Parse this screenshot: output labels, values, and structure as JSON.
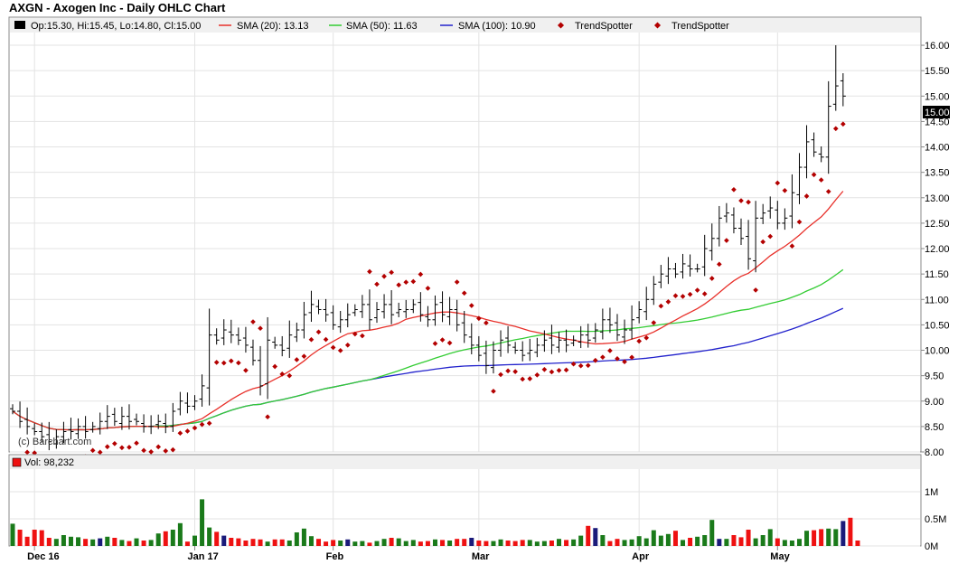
{
  "header": {
    "title": "AXGN - Axogen Inc - Daily OHLC Chart"
  },
  "legend": {
    "ohlc": "Op:15.30, Hi:15.45, Lo:14.80, Cl:15.00",
    "sma20": "SMA (20): 13.13",
    "sma50": "SMA (50): 11.63",
    "sma100": "SMA (100): 10.90",
    "trend1": "TrendSpotter",
    "trend2": "TrendSpotter"
  },
  "watermark": "(c) Barchart.com",
  "volume_label": "Vol: 98,232",
  "colors": {
    "sma20": "#e8302a",
    "sma50": "#33cc33",
    "sma100": "#2222cc",
    "trend": "#b30000",
    "vol_up": "#1a7a1a",
    "vol_down": "#ee1111",
    "vol_neutral": "#1a1a7a",
    "last_price_bg": "#000000"
  },
  "chart_data": [
    {
      "type": "ohlc",
      "title": "AXGN - Axogen Inc - Daily OHLC Chart",
      "ylim": [
        8.0,
        16.25
      ],
      "yticks": [
        8.0,
        8.5,
        9.0,
        9.5,
        10.0,
        10.5,
        11.0,
        11.5,
        12.0,
        12.5,
        13.0,
        13.5,
        14.0,
        14.5,
        15.0,
        15.5,
        16.0
      ],
      "ytick_labels": [
        "8.00",
        "8.50",
        "9.00",
        "9.50",
        "10.00",
        "10.50",
        "11.00",
        "11.50",
        "12.00",
        "12.50",
        "13.00",
        "13.50",
        "14.00",
        "14.50",
        "15.00",
        "15.50",
        "16.00"
      ],
      "last_price": "15.00",
      "months": [
        "Dec 16",
        "Jan 17",
        "Feb",
        "Mar",
        "Apr",
        "May"
      ],
      "month_index": [
        3,
        25,
        44,
        64,
        86,
        105
      ],
      "grid": true,
      "close": [
        8.8,
        8.6,
        8.5,
        8.4,
        8.3,
        8.2,
        8.3,
        8.4,
        8.4,
        8.5,
        8.4,
        8.5,
        8.6,
        8.7,
        8.6,
        8.7,
        8.6,
        8.6,
        8.5,
        8.5,
        8.6,
        8.5,
        8.8,
        9.0,
        8.9,
        9.0,
        9.3,
        10.3,
        10.2,
        10.4,
        10.3,
        10.2,
        10.1,
        9.8,
        9.3,
        10.2,
        10.1,
        10.0,
        10.3,
        10.4,
        10.7,
        10.9,
        10.8,
        10.7,
        10.5,
        10.6,
        10.7,
        10.8,
        10.9,
        10.6,
        10.8,
        10.9,
        10.7,
        10.8,
        10.8,
        10.9,
        10.7,
        10.6,
        10.9,
        10.7,
        10.8,
        10.5,
        10.3,
        10.1,
        9.9,
        9.7,
        10.0,
        10.2,
        10.1,
        10.0,
        9.9,
        10.0,
        10.1,
        10.2,
        10.1,
        10.2,
        10.1,
        10.2,
        10.3,
        10.2,
        10.4,
        10.6,
        10.5,
        10.3,
        10.4,
        10.6,
        10.8,
        11.0,
        11.3,
        11.5,
        11.6,
        11.5,
        11.7,
        11.6,
        11.6,
        12.0,
        12.2,
        12.6,
        12.7,
        12.4,
        12.2,
        11.8,
        12.6,
        12.7,
        12.8,
        12.5,
        12.6,
        13.1,
        13.6,
        14.1,
        13.9,
        13.8,
        14.8,
        15.2,
        15.0
      ]
    },
    {
      "type": "bar",
      "title": "Vol: 98,232",
      "ylim": [
        0,
        1400000
      ],
      "yticks": [
        0,
        500000,
        1000000
      ],
      "ytick_labels": [
        "0M",
        "0.5M",
        "1M"
      ],
      "values": [
        410,
        300,
        170,
        300,
        290,
        150,
        130,
        200,
        170,
        160,
        130,
        120,
        140,
        170,
        150,
        110,
        90,
        140,
        100,
        110,
        230,
        270,
        300,
        420,
        80,
        190,
        860,
        340,
        260,
        190,
        150,
        140,
        100,
        130,
        120,
        80,
        120,
        120,
        100,
        250,
        320,
        180,
        130,
        80,
        110,
        100,
        120,
        80,
        90,
        60,
        90,
        130,
        150,
        140,
        90,
        110,
        80,
        90,
        120,
        110,
        100,
        130,
        130,
        150,
        100,
        90,
        90,
        120,
        100,
        90,
        110,
        110,
        80,
        90,
        100,
        130,
        110,
        120,
        190,
        370,
        330,
        200,
        90,
        130,
        110,
        120,
        180,
        140,
        290,
        190,
        220,
        280,
        110,
        150,
        170,
        200,
        480,
        130,
        130,
        200,
        160,
        300,
        140,
        200,
        310,
        140,
        110,
        100,
        130,
        280,
        290,
        310,
        320,
        310,
        460,
        520,
        100
      ]
    }
  ]
}
